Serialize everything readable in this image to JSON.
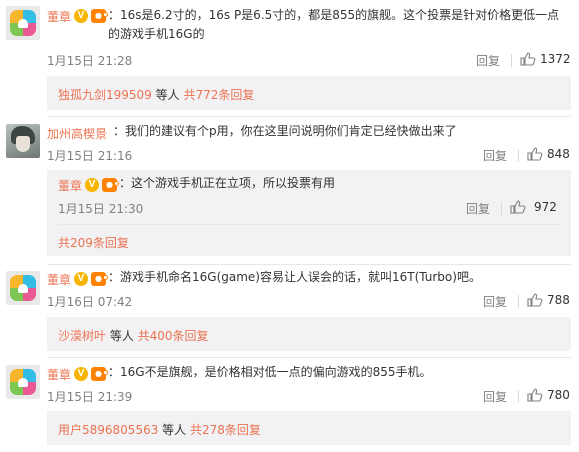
{
  "comments": [
    {
      "user": "董章",
      "text": "：16s是6.2寸的，16s P是6.5寸的，都是855的旗舰。这个投票是针对价格更低一点的游戏手机16G的",
      "time": "1月15日 21:28",
      "reply": "回复",
      "likes": "1372",
      "sub_summary": {
        "user": "独孤九剑199509",
        "mid": " 等人 ",
        "count": "共772条回复"
      }
    },
    {
      "user": "加州高楔景",
      "text": "：我们的建议有个p用，你在这里问说明你们肯定已经快做出来了",
      "time": "1月15日 21:16",
      "reply": "回复",
      "likes": "848",
      "sub_reply": {
        "user": "董章",
        "text": "：这个游戏手机正在立项，所以投票有用",
        "time": "1月15日 21:30",
        "reply": "回复",
        "likes": "972"
      },
      "sub_total": "共209条回复"
    },
    {
      "user": "董章",
      "text": "：游戏手机命名16G(game)容易让人误会的话，就叫16T(Turbo)吧。",
      "time": "1月16日 07:42",
      "reply": "回复",
      "likes": "788",
      "sub_summary": {
        "user": "沙漠树叶",
        "mid": " 等人 ",
        "count": "共400条回复"
      }
    },
    {
      "user": "董章",
      "text": "：16G不是旗舰，是价格相对低一点的偏向游戏的855手机。",
      "time": "1月15日 21:39",
      "reply": "回复",
      "likes": "780",
      "sub_summary": {
        "user": "用户5896805563",
        "mid": " 等人 ",
        "count": "共278条回复"
      }
    }
  ],
  "colors": {
    "username": "#eb7350",
    "text": "#333333",
    "meta": "#808080",
    "reply_bg": "#f2f2f5"
  },
  "icons": [
    "verified-v-badge",
    "member-badge",
    "thumb-up-icon"
  ]
}
